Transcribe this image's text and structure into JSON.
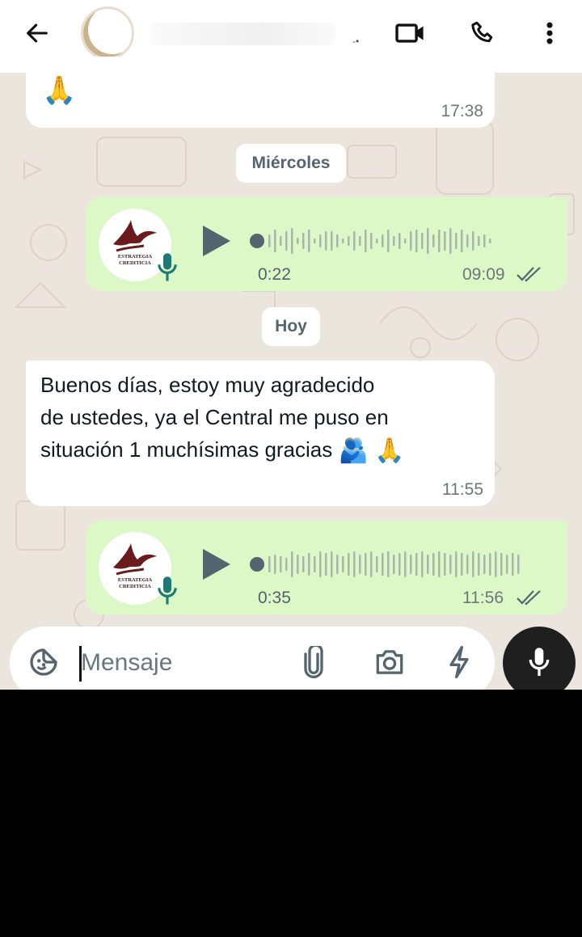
{
  "header": {
    "back_icon": "arrow-left-icon",
    "contact_name": "",
    "icons": [
      "video-call-icon",
      "phone-icon",
      "more-vertical-icon"
    ]
  },
  "messages": [
    {
      "type": "incoming-text",
      "text": "",
      "emoji": "🙏",
      "time": "17:38"
    },
    {
      "type": "day-separator",
      "label": "Miércoles"
    },
    {
      "type": "outgoing-voice",
      "duration": "0:22",
      "time": "09:09",
      "status": "double-check"
    },
    {
      "type": "day-separator",
      "label": "Hoy"
    },
    {
      "type": "incoming-text",
      "line1": "Buenos días, estoy muy agradecido",
      "line2": "de ustedes, ya el Central me puso en",
      "line3": "situación 1 muchísimas gracias",
      "emoji1": "🫂",
      "emoji2": "🙏",
      "time": "11:55"
    },
    {
      "type": "outgoing-voice",
      "duration": "0:35",
      "time": "11:56",
      "status": "double-check"
    }
  ],
  "voice_logo": {
    "line1": "ESTRATEGIA",
    "line2": "CREDITICIA"
  },
  "composer": {
    "placeholder": "Mensaje",
    "icons": [
      "sticker-icon",
      "attach-icon",
      "camera-icon",
      "flash-icon"
    ],
    "mic_icon": "mic-icon"
  },
  "colors": {
    "incoming": "#ffffff",
    "outgoing": "#dcf8c6",
    "wallpaper": "#ece5dd",
    "accent_dark": "#1f1f1f"
  }
}
